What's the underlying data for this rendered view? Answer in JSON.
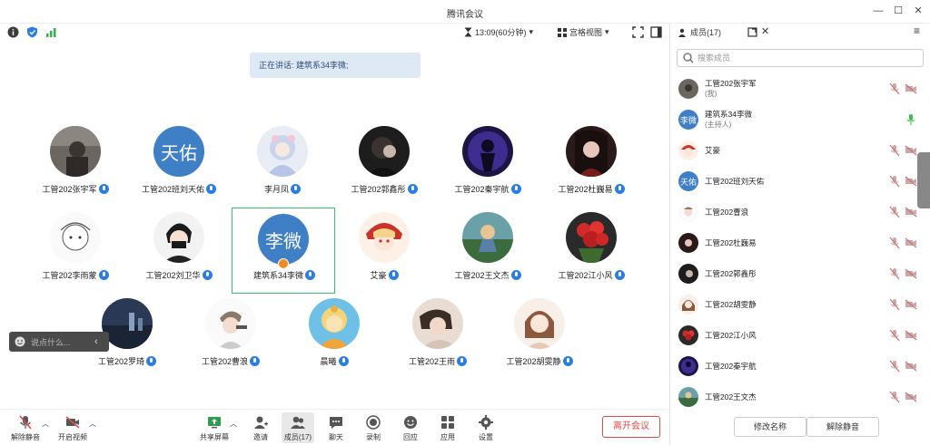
{
  "window": {
    "title": "腾讯会议"
  },
  "toolbar_top": {
    "time": "13:09(60分钟)",
    "view": "宫格视图"
  },
  "speaking": "正在讲话: 建筑系34李微;",
  "tiles": [
    {
      "name": "工管202张宇军",
      "avatar": "photo-1"
    },
    {
      "name": "工管202班刘天佑",
      "avatar_text": "天佑"
    },
    {
      "name": "李月凤",
      "avatar": "photo-3"
    },
    {
      "name": "工管202郭鑫彤",
      "avatar": "photo-4"
    },
    {
      "name": "工管202秦宇航",
      "avatar": "photo-5"
    },
    {
      "name": "工管202杜巍易",
      "avatar": "photo-6"
    },
    {
      "name": "工管202李雨蒙",
      "avatar": "photo-7"
    },
    {
      "name": "工管202刘卫华",
      "avatar": "photo-8"
    },
    {
      "name": "建筑系34李微",
      "avatar_text": "李微",
      "active": true
    },
    {
      "name": "艾豪",
      "avatar": "photo-10"
    },
    {
      "name": "工管202王文杰",
      "avatar": "photo-11"
    },
    {
      "name": "工管202江小风",
      "avatar": "photo-12"
    },
    {
      "name": "工管202罗琦",
      "avatar": "photo-13"
    },
    {
      "name": "工管202曹浪",
      "avatar": "photo-14"
    },
    {
      "name": "晨曦",
      "avatar": "photo-15"
    },
    {
      "name": "工管202王雨",
      "avatar": "photo-16"
    },
    {
      "name": "工管202胡雯静",
      "avatar": "photo-17"
    }
  ],
  "chat": {
    "placeholder": "说点什么...",
    "collapse": "‹"
  },
  "bottom": {
    "unmute": "解除静音",
    "video": "开启视频",
    "share": "共享屏幕",
    "invite": "邀请",
    "members": "成员(17)",
    "chat": "聊天",
    "record": "录制",
    "reaction": "回应",
    "apps": "应用",
    "settings": "设置",
    "leave": "离开会议"
  },
  "panel": {
    "tab": "成员(17)",
    "search_placeholder": "搜索成员",
    "rename": "修改名称",
    "unmute": "解除静音",
    "members": [
      {
        "name": "工管202张宇军",
        "role": "(我)"
      },
      {
        "name": "建筑系34李微",
        "role": "(主持人)",
        "avatar_text": "李微",
        "speaking": true
      },
      {
        "name": "艾豪",
        "role": ""
      },
      {
        "name": "工管202班刘天佑",
        "role": "",
        "avatar_text": "天佑"
      },
      {
        "name": "工管202曹浪",
        "role": ""
      },
      {
        "name": "工管202杜巍易",
        "role": ""
      },
      {
        "name": "工管202郭鑫彤",
        "role": ""
      },
      {
        "name": "工管202胡雯静",
        "role": ""
      },
      {
        "name": "工管202江小风",
        "role": ""
      },
      {
        "name": "工管202秦宇航",
        "role": ""
      },
      {
        "name": "工管202王文杰",
        "role": ""
      }
    ]
  },
  "colors": {
    "accent": "#2a7de1",
    "leave": "#e04848",
    "active_border": "#3bbf6a"
  }
}
